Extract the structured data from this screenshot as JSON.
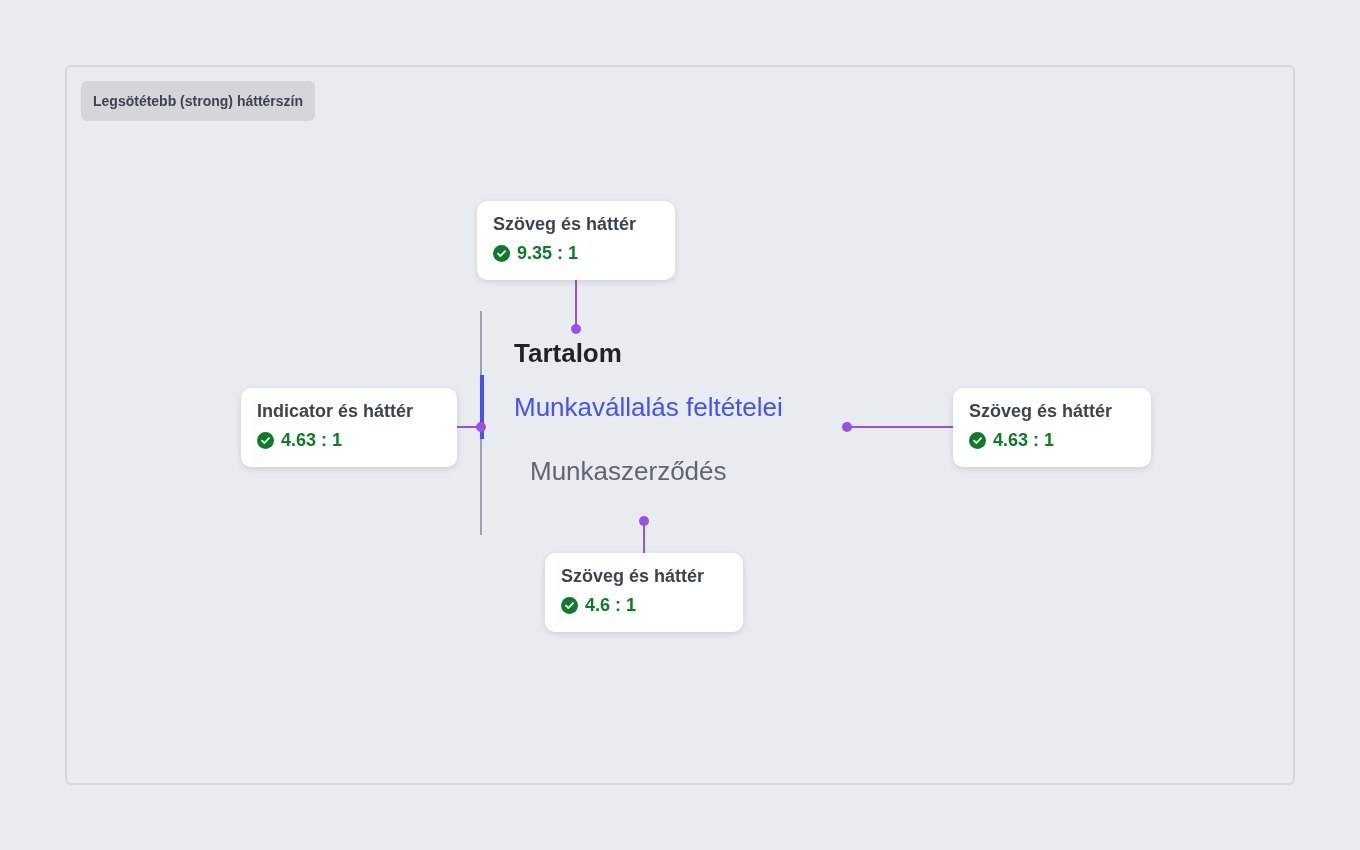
{
  "badge": "Legsötétebb (strong) háttérszín",
  "toc": {
    "title": "Tartalom",
    "items": [
      {
        "label": "Munkavállalás feltételei",
        "selected": true,
        "children": [
          {
            "label": "Munkaszerződés",
            "selected": false
          }
        ]
      }
    ]
  },
  "annotations": [
    {
      "title": "Szöveg és háttér",
      "ratio": "9.35 : 1"
    },
    {
      "title": "Indicator és háttér",
      "ratio": "4.63 : 1"
    },
    {
      "title": "Szöveg és háttér",
      "ratio": "4.63 : 1"
    },
    {
      "title": "Szöveg és háttér",
      "ratio": "4.6 : 1"
    }
  ]
}
